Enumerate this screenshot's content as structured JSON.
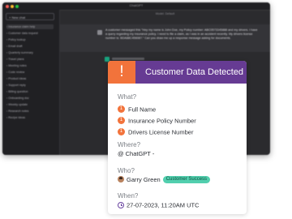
{
  "app": {
    "title": "ChatGPT",
    "new_chat_label": "+ New chat",
    "sidebar_items": [
      "Insurance claim help",
      "Customer data request",
      "Policy lookup",
      "Email draft",
      "Quarterly summary",
      "Travel plans",
      "Meeting notes",
      "Code review",
      "Product ideas",
      "Support reply",
      "Billing question",
      "Onboarding doc",
      "Weekly update",
      "Research notes",
      "Recipe ideas"
    ],
    "conversation_header": "Model: Default",
    "message_text": "A customer messaged this \"Hey my name is John Doe, my Policy number: ABC0573345888 and my drivers. I have a query regarding my insurance policy. I need to file a claim, as I was in an accident recently. My drivers license number is: BDA88C456087.\" Can you draw me up a response message asking for documents."
  },
  "alert": {
    "icon_glyph": "!",
    "title": "Customer Data Detected",
    "what_label": "What?",
    "items": [
      {
        "num": "1",
        "label": "Full Name"
      },
      {
        "num": "1",
        "label": "Insurance Policy Number"
      },
      {
        "num": "1",
        "label": "Drivers License Number"
      }
    ],
    "where_label": "Where?",
    "where_value": "ChatGPT -",
    "who_label": "Who?",
    "who_name": "Garry Green",
    "who_tag": "Customer Success",
    "when_label": "When?",
    "when_value": "27-07-2023, 11:20AM UTC"
  }
}
